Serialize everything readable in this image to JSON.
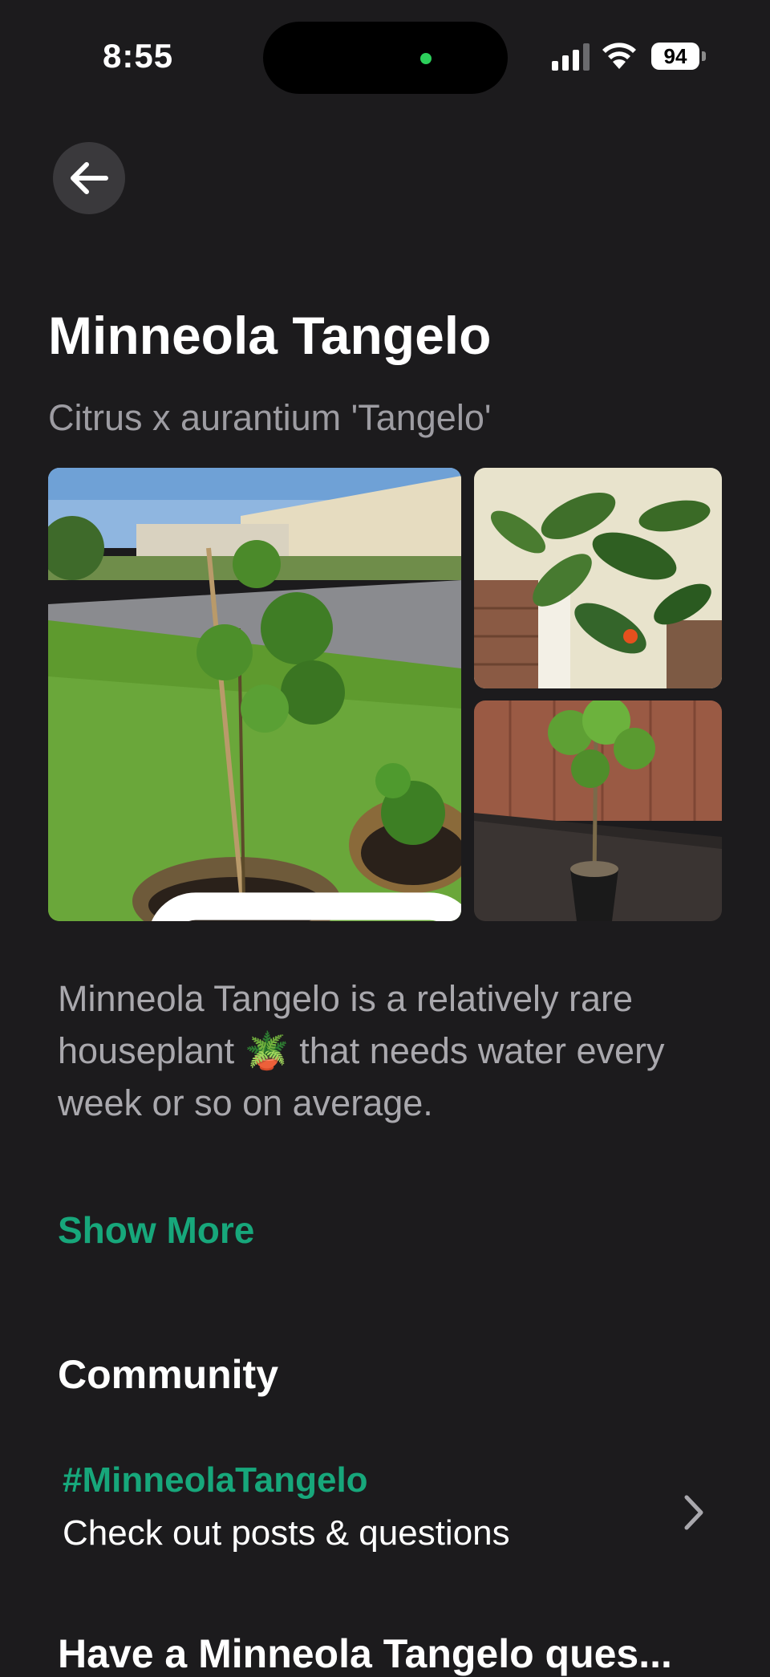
{
  "status_bar": {
    "time": "8:55",
    "battery_level": "94",
    "colors": {
      "camera_indicator": "#2ccf5b"
    }
  },
  "nav": {
    "back_icon": "arrow-left-icon"
  },
  "plant": {
    "common_name": "Minneola Tangelo",
    "scientific_name": "Citrus x aurantium 'Tangelo'"
  },
  "gallery": {
    "photos": [
      {
        "name": "tangelo-sapling-in-pot-on-lawn"
      },
      {
        "name": "tangelo-leaves-closeup"
      },
      {
        "name": "tangelo-tree-in-mulch-bed"
      }
    ],
    "gallery_icon": "photo-gallery-icon"
  },
  "description": {
    "text_before": "Minneola Tangelo is a relatively rare houseplant ",
    "emoji": "🪴",
    "text_after": " that needs water every week or so on average.",
    "show_more_label": "Show More"
  },
  "community": {
    "heading": "Community",
    "hashtag": "#MinneolaTangelo",
    "subtitle": "Check out posts & questions",
    "chevron_icon": "chevron-right-icon"
  },
  "questions": {
    "heading": "Have a Minneola Tangelo ques..."
  },
  "colors": {
    "background": "#1c1b1d",
    "accent": "#17a77b",
    "secondary_text": "#9d9ca2"
  }
}
